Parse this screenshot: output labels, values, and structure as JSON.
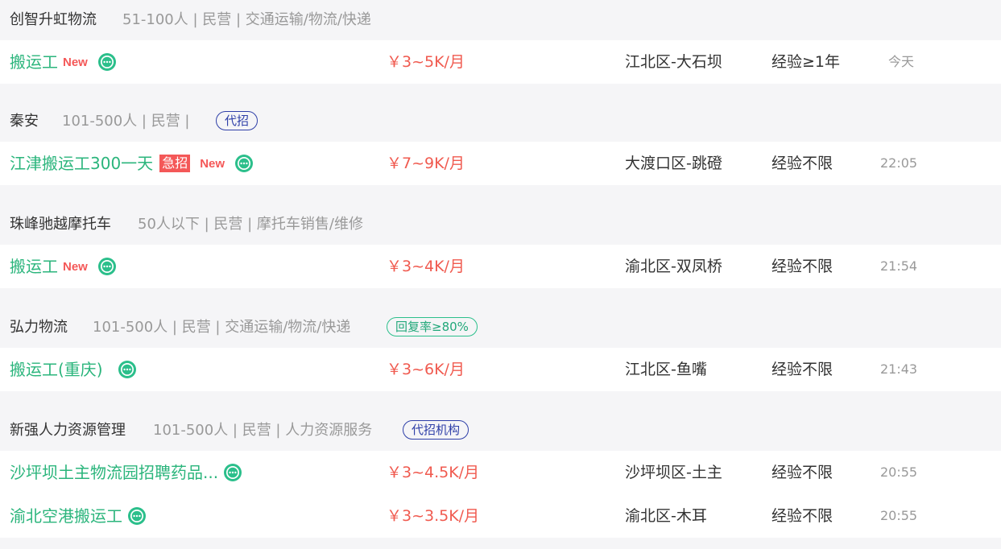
{
  "groups": [
    {
      "company": {
        "name": "创智升虹物流",
        "meta": "51-100人 | 民营 | 交通运输/物流/快递",
        "tag": ""
      },
      "jobs": [
        {
          "title": "搬运工",
          "urgent": "",
          "new": "New",
          "salary": "￥3~5K/月",
          "location": "江北区-大石坝",
          "experience": "经验≥1年",
          "time": "今天"
        }
      ]
    },
    {
      "company": {
        "name": "秦安",
        "meta": "101-500人 | 民营 |",
        "tag": "代招"
      },
      "jobs": [
        {
          "title": "江津搬运工300一天",
          "urgent": "急招",
          "new": "New",
          "salary": "￥7~9K/月",
          "location": "大渡口区-跳磴",
          "experience": "经验不限",
          "time": "22:05"
        }
      ]
    },
    {
      "company": {
        "name": "珠峰驰越摩托车",
        "meta": "50人以下 | 民营 | 摩托车销售/维修",
        "tag": ""
      },
      "jobs": [
        {
          "title": "搬运工",
          "urgent": "",
          "new": "New",
          "salary": "￥3~4K/月",
          "location": "渝北区-双凤桥",
          "experience": "经验不限",
          "time": "21:54"
        }
      ]
    },
    {
      "company": {
        "name": "弘力物流",
        "meta": "101-500人 | 民营 | 交通运输/物流/快递",
        "tag": "回复率≥80%"
      },
      "jobs": [
        {
          "title": "搬运工(重庆)",
          "urgent": "",
          "new": "",
          "salary": "￥3~6K/月",
          "location": "江北区-鱼嘴",
          "experience": "经验不限",
          "time": "21:43"
        }
      ]
    },
    {
      "company": {
        "name": "新强人力资源管理",
        "meta": "101-500人 | 民营 | 人力资源服务",
        "tag": "代招机构"
      },
      "jobs": [
        {
          "title": "沙坪坝土主物流园招聘药品...",
          "urgent": "",
          "new": "",
          "salary": "￥3~4.5K/月",
          "location": "沙坪坝区-土主",
          "experience": "经验不限",
          "time": "20:55"
        },
        {
          "title": "渝北空港搬运工",
          "urgent": "",
          "new": "",
          "salary": "￥3~3.5K/月",
          "location": "渝北区-木耳",
          "experience": "经验不限",
          "time": "20:55"
        }
      ]
    }
  ],
  "icons": {
    "chat": "chat-bubble-icon"
  },
  "colors": {
    "job_title": "#2bb57c",
    "salary": "#f05a4f",
    "badge_red": "#f45858",
    "tag_blue": "#2e3fa8",
    "tag_green": "#22a87a",
    "chat_icon": "#2bbf8b"
  }
}
